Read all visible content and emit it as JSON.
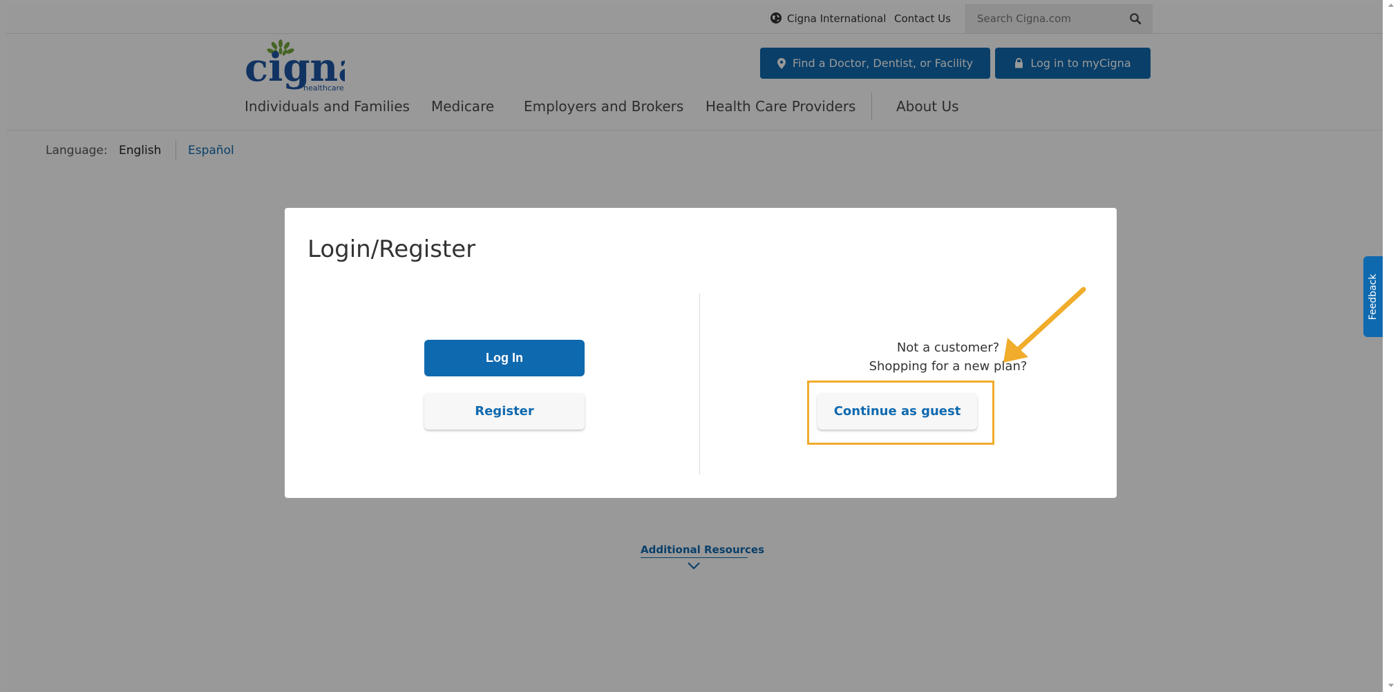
{
  "utility_bar": {
    "international_label": "Cigna International",
    "contact_label": "Contact Us",
    "search_placeholder": "Search Cigna.com"
  },
  "logo": {
    "wordmark": "cigna",
    "subtext": "healthcare",
    "brand_color": "#1d56a4",
    "leaf_color": "#76a83c"
  },
  "header": {
    "find_doctor_label": "Find a Doctor, Dentist, or Facility",
    "login_mycigna_label": "Log in to myCigna"
  },
  "nav": {
    "items": [
      {
        "label": "Individuals and Families"
      },
      {
        "label": "Medicare"
      },
      {
        "label": "Employers and Brokers"
      },
      {
        "label": "Health Care Providers"
      },
      {
        "label": "About Us"
      }
    ]
  },
  "language": {
    "label": "Language:",
    "current": "English",
    "alternate": "Español"
  },
  "additional_resources": "Additional Resources",
  "feedback_label": "Feedback",
  "modal": {
    "title": "Login/Register",
    "login_label": "Log In",
    "register_label": "Register",
    "not_customer_line1": "Not a customer?",
    "not_customer_line2": "Shopping for a new plan?",
    "guest_label": "Continue as guest"
  },
  "colors": {
    "primary_blue": "#0f69af",
    "highlight": "#f0ac2a",
    "overlay_bg": "#9a9a9a"
  }
}
